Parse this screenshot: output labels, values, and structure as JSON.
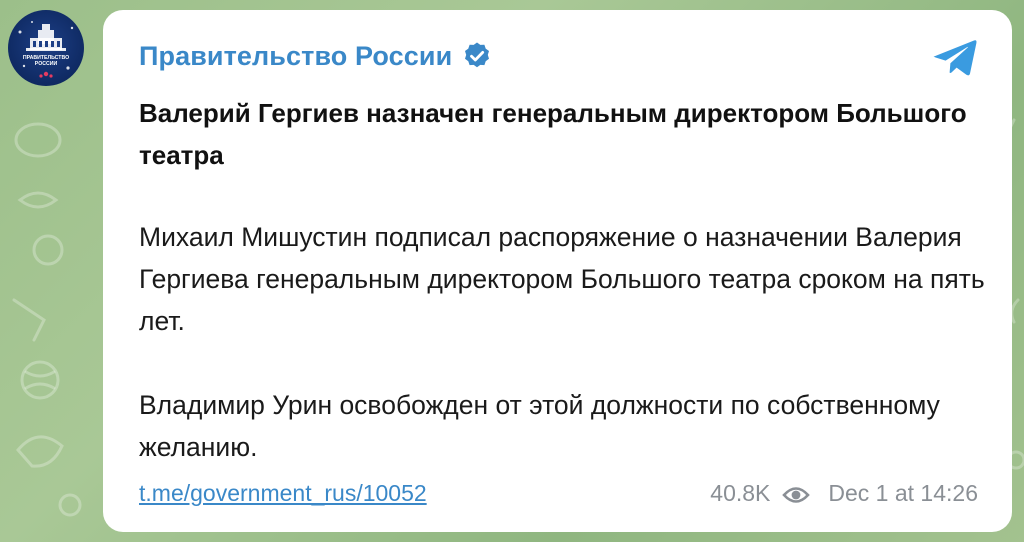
{
  "channel": {
    "name": "Правительство России",
    "avatar_label_line1": "ПРАВИТЕЛЬСТВО",
    "avatar_label_line2": "РОССИИ",
    "verified_icon": "verified-badge-icon",
    "telegram_icon": "telegram-plane-icon"
  },
  "message": {
    "headline": "Валерий Гергиев назначен генеральным директором Большого театра",
    "paragraph1": "Михаил Мишустин подписал распоряжение о назначении Валерия Гергиева генеральным директором Большого театра сроком на пять лет.",
    "paragraph2": "Владимир Урин освобожден от этой должности по собственному желанию."
  },
  "footer": {
    "link": "t.me/government_rus/10052",
    "views": "40.8K",
    "views_icon": "eye-icon",
    "timestamp": "Dec 1 at 14:26"
  },
  "colors": {
    "accent": "#3a88c8",
    "background": "#a3c28f",
    "bubble": "#ffffff",
    "meta": "#8a8f95"
  }
}
